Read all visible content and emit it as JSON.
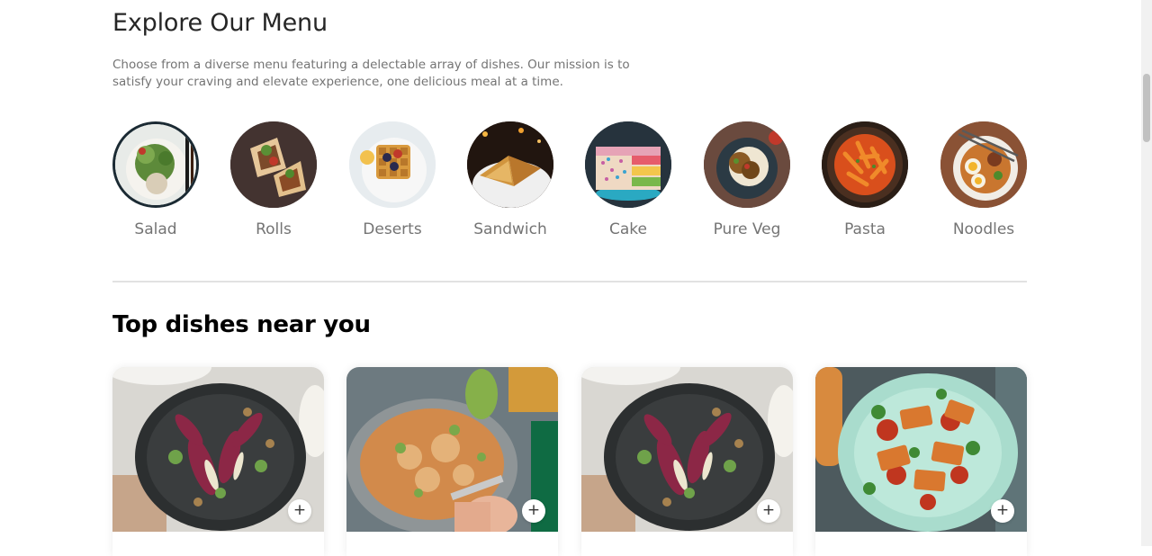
{
  "explore": {
    "title": "Explore Our Menu",
    "description": "Choose from a diverse menu featuring a delectable array of dishes. Our mission is to satisfy your craving and elevate experience, one delicious meal at a time."
  },
  "menu": [
    {
      "label": "Salad"
    },
    {
      "label": "Rolls"
    },
    {
      "label": "Deserts"
    },
    {
      "label": "Sandwich"
    },
    {
      "label": "Cake"
    },
    {
      "label": "Pure Veg"
    },
    {
      "label": "Pasta"
    },
    {
      "label": "Noodles"
    }
  ],
  "top_dishes": {
    "title": "Top dishes near you",
    "add_label": "+"
  }
}
